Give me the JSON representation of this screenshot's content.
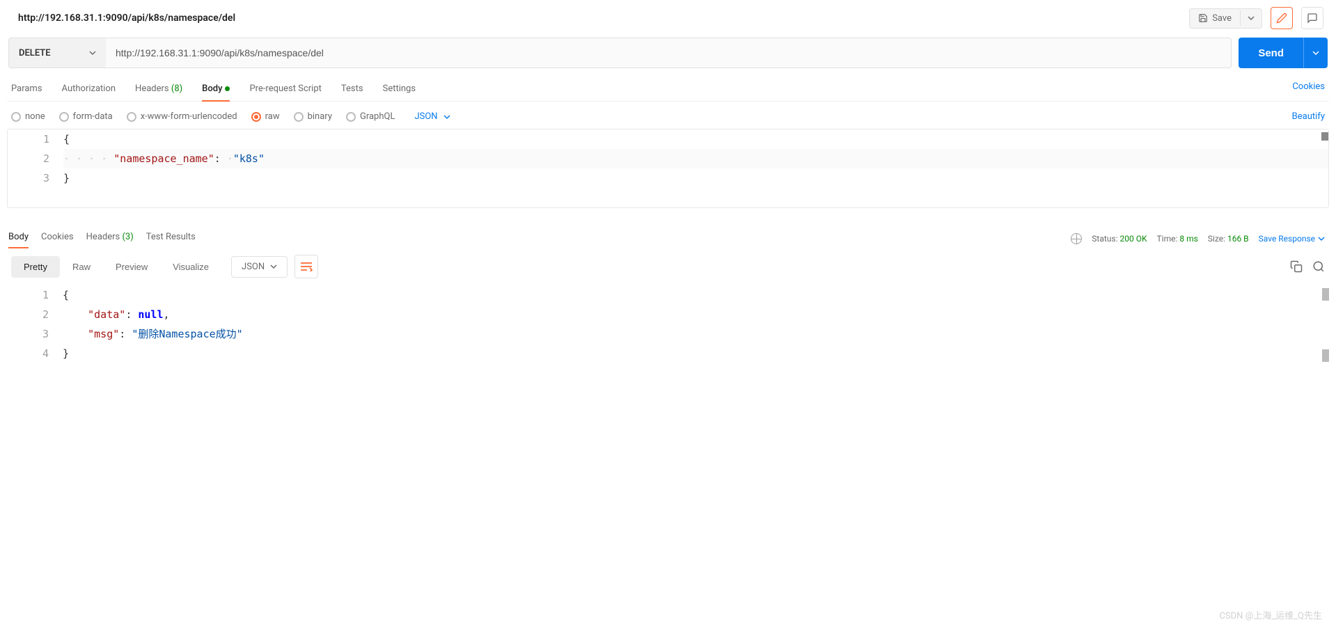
{
  "title": "http://192.168.31.1:9090/api/k8s/namespace/del",
  "save_label": "Save",
  "request": {
    "method": "DELETE",
    "url": "http://192.168.31.1:9090/api/k8s/namespace/del",
    "send_label": "Send"
  },
  "req_tabs": {
    "params": "Params",
    "auth": "Authorization",
    "headers_label": "Headers",
    "headers_count": "(8)",
    "body": "Body",
    "prerequest": "Pre-request Script",
    "tests": "Tests",
    "settings": "Settings",
    "cookies_link": "Cookies"
  },
  "body_types": {
    "none": "none",
    "formdata": "form-data",
    "urlencoded": "x-www-form-urlencoded",
    "raw": "raw",
    "binary": "binary",
    "graphql": "GraphQL",
    "format": "JSON",
    "beautify": "Beautify"
  },
  "request_body": {
    "lines": [
      "1",
      "2",
      "3"
    ],
    "key": "\"namespace_name\"",
    "value": "\"k8s\""
  },
  "resp_tabs": {
    "body": "Body",
    "cookies": "Cookies",
    "headers_label": "Headers",
    "headers_count": "(3)",
    "tests": "Test Results"
  },
  "resp_meta": {
    "status_label": "Status:",
    "status_value": "200 OK",
    "time_label": "Time:",
    "time_value": "8 ms",
    "size_label": "Size:",
    "size_value": "166 B",
    "save_response": "Save Response"
  },
  "view_modes": {
    "pretty": "Pretty",
    "raw": "Raw",
    "preview": "Preview",
    "visualize": "Visualize",
    "format": "JSON"
  },
  "response_body": {
    "lines": [
      "1",
      "2",
      "3",
      "4"
    ],
    "data_key": "\"data\"",
    "data_value": "null",
    "msg_key": "\"msg\"",
    "msg_value": "\"删除Namespace成功\""
  },
  "watermark": "CSDN @上海_运维_Q先生"
}
